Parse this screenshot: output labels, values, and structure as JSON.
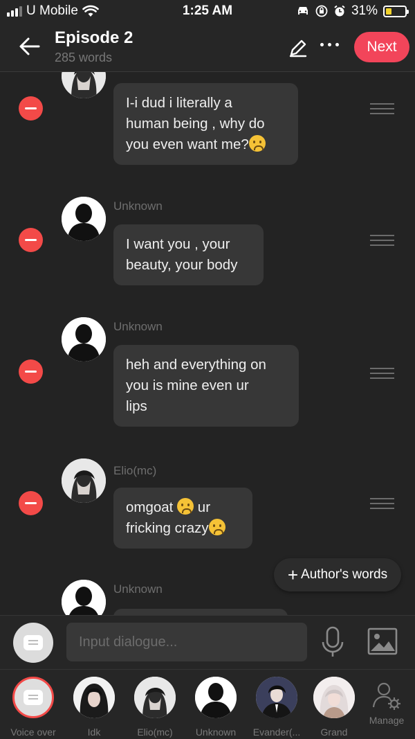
{
  "status_bar": {
    "carrier": "U Mobile",
    "time": "1:25 AM",
    "battery": "31%",
    "battery_level": 0.31
  },
  "header": {
    "title": "Episode 2",
    "subtitle": "285 words",
    "next_label": "Next"
  },
  "messages": [
    {
      "speaker": "",
      "lines": [
        "I-i dud i literally a",
        "human being , why do",
        "you even want me?"
      ],
      "emoji": [
        "worried-emoji"
      ]
    },
    {
      "speaker": "Unknown",
      "lines": [
        "I want you , your",
        "beauty, your body"
      ],
      "emoji": []
    },
    {
      "speaker": "Unknown",
      "lines": [
        "heh and everything on",
        "you is mine even ur",
        "lips"
      ],
      "emoji": []
    },
    {
      "speaker": "Elio(mc)",
      "lines": [
        "omgoat",
        "ur",
        "fricking crazy"
      ],
      "emoji": [
        "worried-emoji",
        "confounded-emoji"
      ]
    },
    {
      "speaker": "Unknown",
      "lines": [],
      "emoji": []
    }
  ],
  "authors_words_label": "Author's words",
  "input": {
    "placeholder": "Input dialogue..."
  },
  "characters": [
    {
      "label": "Voice over",
      "icon": "chat-bubble-icon"
    },
    {
      "label": "Idk",
      "icon": "avatar-dark-hair"
    },
    {
      "label": "Elio(mc)",
      "icon": "avatar-anime-boy"
    },
    {
      "label": "Unknown",
      "icon": "avatar-silhouette"
    },
    {
      "label": "Evander(...",
      "icon": "avatar-dark-suit"
    },
    {
      "label": "Grand",
      "icon": "avatar-white-hair"
    },
    {
      "label": "Manage",
      "icon": "manage-user-gear-icon"
    }
  ],
  "colors": {
    "accent": "#f2455a",
    "delete": "#f34a48",
    "background": "#232323",
    "bubble": "#373737",
    "battery": "#f2d32c"
  }
}
